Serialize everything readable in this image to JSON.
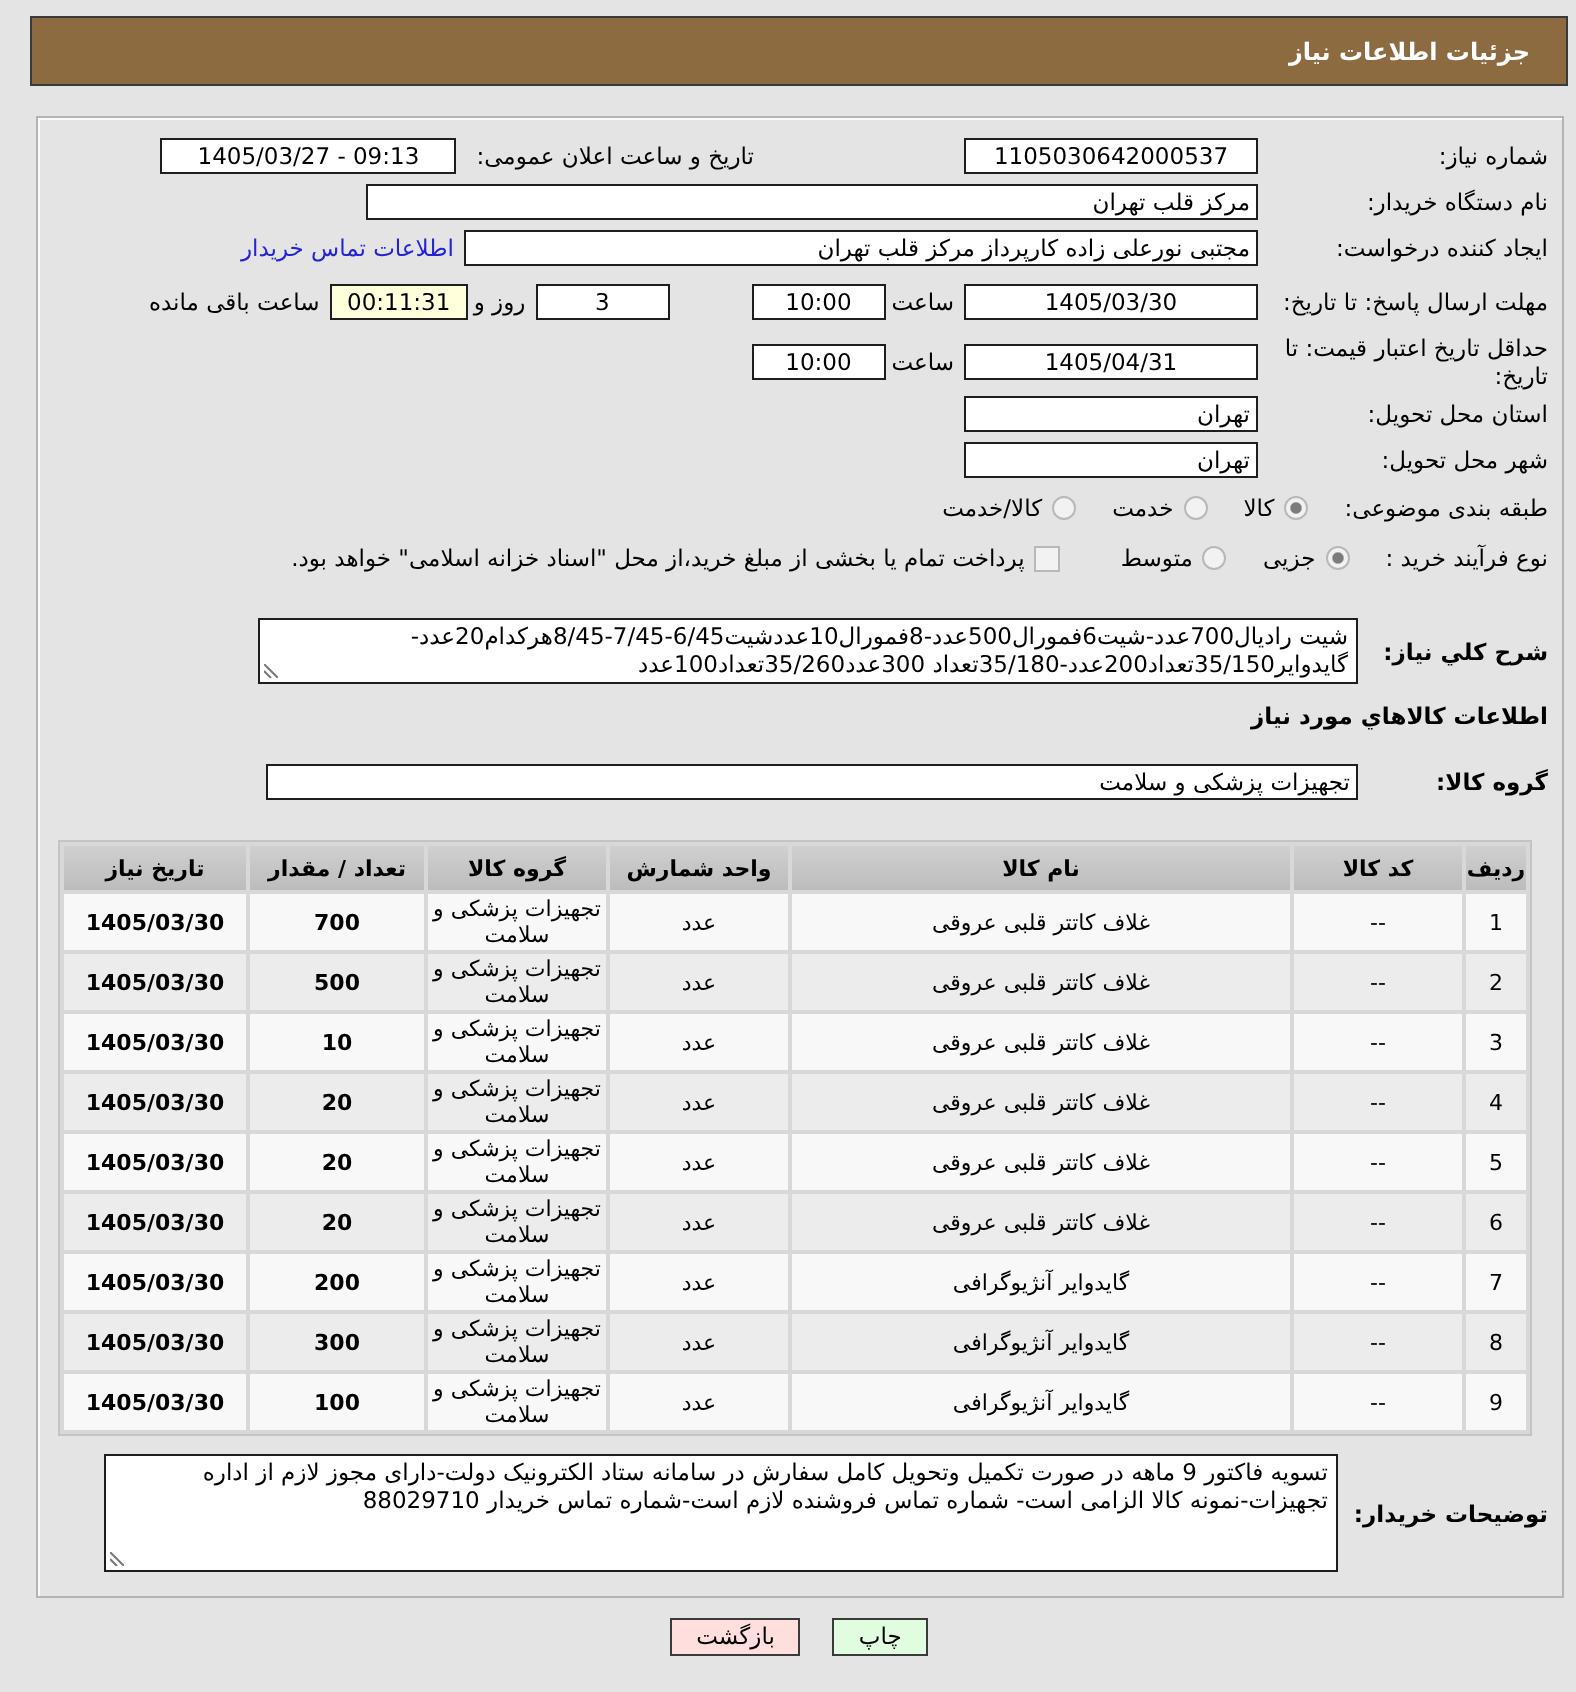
{
  "header": {
    "title": "جزئیات اطلاعات نیاز"
  },
  "rows": [
    {
      "kind": "pair",
      "label": "شماره نیاز:",
      "value": "1105030642000537",
      "label_2": "تاریخ و ساعت اعلان عمومی:",
      "value_2": "1405/03/27 - 09:13"
    },
    {
      "kind": "wide",
      "label": "نام دستگاه خریدار:",
      "value": "مرکز قلب تهران"
    },
    {
      "kind": "link",
      "label": "ایجاد کننده درخواست:",
      "value": "مجتبی نورعلی زاده کارپرداز مرکز قلب تهران",
      "link": "اطلاعات تماس خریدار"
    },
    {
      "kind": "deadline",
      "label": "مهلت ارسال پاسخ: تا تاریخ:",
      "date": "1405/03/30",
      "time_label": "ساعت",
      "time": "10:00",
      "days": "3",
      "days_label": "روز و",
      "remaining": "00:11:31",
      "remaining_label": "ساعت باقی مانده"
    },
    {
      "kind": "deadline",
      "label": "حداقل تاریخ اعتبار قیمت: تا تاریخ:",
      "date": "1405/04/31",
      "time_label": "ساعت",
      "time": "10:00"
    },
    {
      "kind": "short",
      "label": "استان محل تحویل:",
      "value": "تهران"
    },
    {
      "kind": "short",
      "label": "شهر محل تحویل:",
      "value": "تهران"
    },
    {
      "kind": "radios",
      "label": "طبقه بندی موضوعی:",
      "options": [
        {
          "label": "کالا",
          "selected": true
        },
        {
          "label": "خدمت",
          "selected": false
        },
        {
          "label": "کالا/خدمت",
          "selected": false
        }
      ]
    },
    {
      "kind": "radios",
      "label": "نوع فرآیند خرید :",
      "options": [
        {
          "label": "جزیی",
          "selected": true
        },
        {
          "label": "متوسط",
          "selected": false
        }
      ],
      "checkbox": {
        "label": "پرداخت تمام یا بخشی از مبلغ خرید،از محل \"اسناد خزانه اسلامی\" خواهد بود.",
        "checked": false
      }
    }
  ],
  "description": {
    "label": "شرح کلي نياز:",
    "text": "شیت رادیال700عدد-شیت6فمورال500عدد-8فمورال10عددشیت6/45-7/45-8/45هرکدام20عدد-گایدوایر35/150تعداد200عدد-35/180تعداد 300عدد35/260تعداد100عدد"
  },
  "items_section": {
    "title": "اطلاعات کالاهاي مورد نياز",
    "group_label": "گروه کالا:",
    "group_value": "تجهیزات پزشکی و سلامت",
    "columns": [
      "ردیف",
      "کد کالا",
      "نام کالا",
      "واحد شمارش",
      "گروه کالا",
      "تعداد / مقدار",
      "تاریخ نیاز"
    ],
    "rows": [
      [
        "1",
        "--",
        "غلاف کاتتر قلبی عروقی",
        "عدد",
        "تجهیزات پزشکی و سلامت",
        "700",
        "1405/03/30"
      ],
      [
        "2",
        "--",
        "غلاف کاتتر قلبی عروقی",
        "عدد",
        "تجهیزات پزشکی و سلامت",
        "500",
        "1405/03/30"
      ],
      [
        "3",
        "--",
        "غلاف کاتتر قلبی عروقی",
        "عدد",
        "تجهیزات پزشکی و سلامت",
        "10",
        "1405/03/30"
      ],
      [
        "4",
        "--",
        "غلاف کاتتر قلبی عروقی",
        "عدد",
        "تجهیزات پزشکی و سلامت",
        "20",
        "1405/03/30"
      ],
      [
        "5",
        "--",
        "غلاف کاتتر قلبی عروقی",
        "عدد",
        "تجهیزات پزشکی و سلامت",
        "20",
        "1405/03/30"
      ],
      [
        "6",
        "--",
        "غلاف کاتتر قلبی عروقی",
        "عدد",
        "تجهیزات پزشکی و سلامت",
        "20",
        "1405/03/30"
      ],
      [
        "7",
        "--",
        "گایدوایر آنژیوگرافی",
        "عدد",
        "تجهیزات پزشکی و سلامت",
        "200",
        "1405/03/30"
      ],
      [
        "8",
        "--",
        "گایدوایر آنژیوگرافی",
        "عدد",
        "تجهیزات پزشکی و سلامت",
        "300",
        "1405/03/30"
      ],
      [
        "9",
        "--",
        "گایدوایر آنژیوگرافی",
        "عدد",
        "تجهیزات پزشکی و سلامت",
        "100",
        "1405/03/30"
      ]
    ]
  },
  "notes": {
    "label": "توضیحات خریدار:",
    "text": "تسویه فاکتور 9 ماهه در صورت تکمیل وتحویل کامل سفارش در سامانه ستاد الکترونیک دولت-دارای مجوز لازم از اداره تجهیزات-نمونه کالا الزامی است- شماره تماس فروشنده لازم است-شماره تماس خریدار 88029710"
  },
  "buttons": [
    {
      "kind": "print",
      "label": "چاپ"
    },
    {
      "kind": "back",
      "label": "بازگشت"
    }
  ]
}
